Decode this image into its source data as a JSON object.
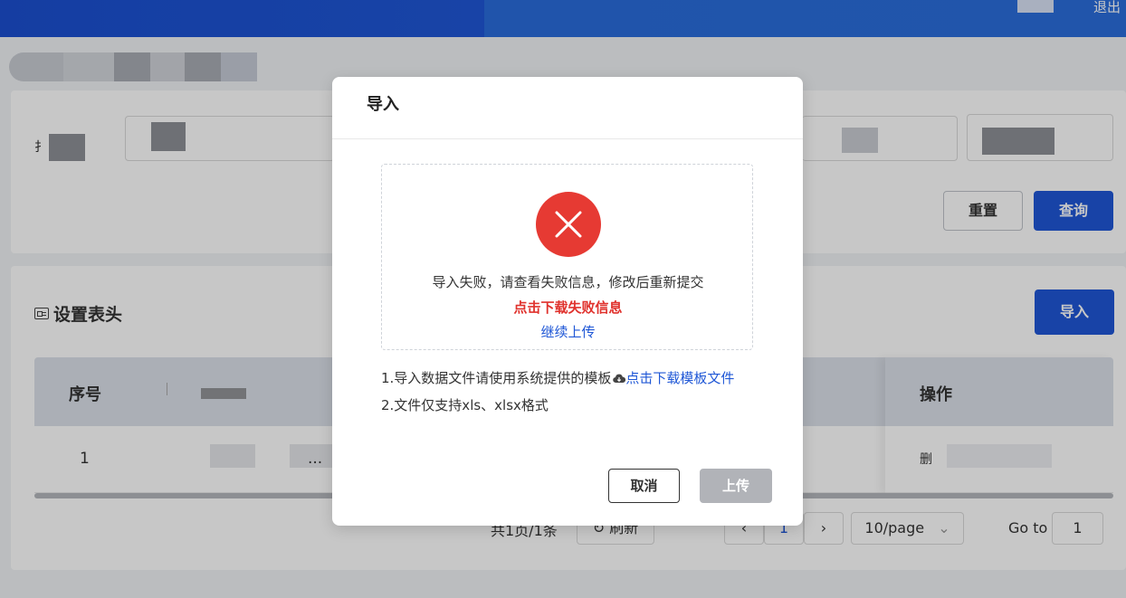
{
  "header": {
    "logout_label": "退出"
  },
  "search": {
    "reset_label": "重置",
    "query_label": "查询"
  },
  "table_section": {
    "title": "设置表头",
    "import_label": "导入",
    "columns": [
      "序号",
      "操作"
    ],
    "rows": [
      {
        "index": "1",
        "ellipsis": "...",
        "action": "删"
      }
    ]
  },
  "pagination": {
    "total_text": "共1页/1条",
    "refresh_label": "刷新",
    "prev": "‹",
    "current_page": "1",
    "next": "›",
    "page_size": "10/page",
    "goto_label": "Go to",
    "goto_value": "1"
  },
  "modal": {
    "title": "导入",
    "error_message": "导入失败，请查看失败信息，修改后重新提交",
    "download_fail_link": "点击下载失败信息",
    "continue_upload_link": "继续上传",
    "tip1_text": "1.导入数据文件请使用系统提供的模板",
    "tip1_link": "点击下载模板文件",
    "tip2_text": "2.文件仅支持xls、xlsx格式",
    "cancel_label": "取消",
    "upload_label": "上传",
    "error_color": "#e63a33",
    "link_color": "#1f57d6"
  },
  "icons": {
    "error": "close-circle-icon",
    "cloud": "cloud-download-icon",
    "table_settings": "table-settings-icon",
    "refresh": "refresh-icon",
    "chevron_down": "chevron-down-icon"
  }
}
